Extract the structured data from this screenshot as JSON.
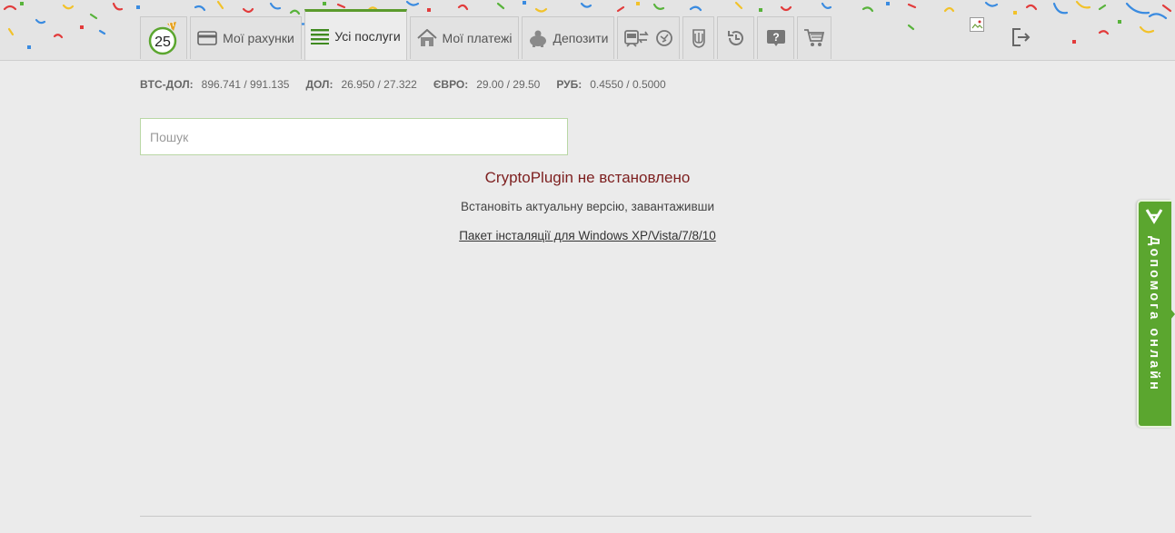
{
  "nav": {
    "badge_number": "25",
    "tabs": [
      {
        "label": "Мої рахунки",
        "icon": "card-icon"
      },
      {
        "label": "Усі послуги",
        "icon": "list-icon"
      },
      {
        "label": "Мої платежі",
        "icon": "house-icon"
      },
      {
        "label": "Депозити",
        "icon": "piggy-bank-icon"
      }
    ],
    "icon_tabs": [
      "transport-icon",
      "ukraine-trident-icon",
      "history-icon",
      "help-question-icon",
      "cart-icon"
    ]
  },
  "rates": [
    {
      "name": "BTC-ДОЛ:",
      "value": "896.741 / 991.135"
    },
    {
      "name": "ДОЛ:",
      "value": "26.950 / 27.322"
    },
    {
      "name": "ЄВРО:",
      "value": "29.00 / 29.50"
    },
    {
      "name": "РУБ:",
      "value": "0.4550 / 0.5000"
    }
  ],
  "search": {
    "placeholder": "Пошук",
    "value": ""
  },
  "message": {
    "title": "CryptoPlugin не встановлено",
    "subtitle": "Встановіть актуальну версію, завантаживши",
    "link": "Пакет інсталяції для Windows XP/Vista/7/8/10"
  },
  "help": {
    "label": "Допомога онлайн",
    "icon": "chevron-down-icon"
  },
  "colors": {
    "accent_green": "#5ba62f",
    "error_red": "#7d1f1f"
  }
}
